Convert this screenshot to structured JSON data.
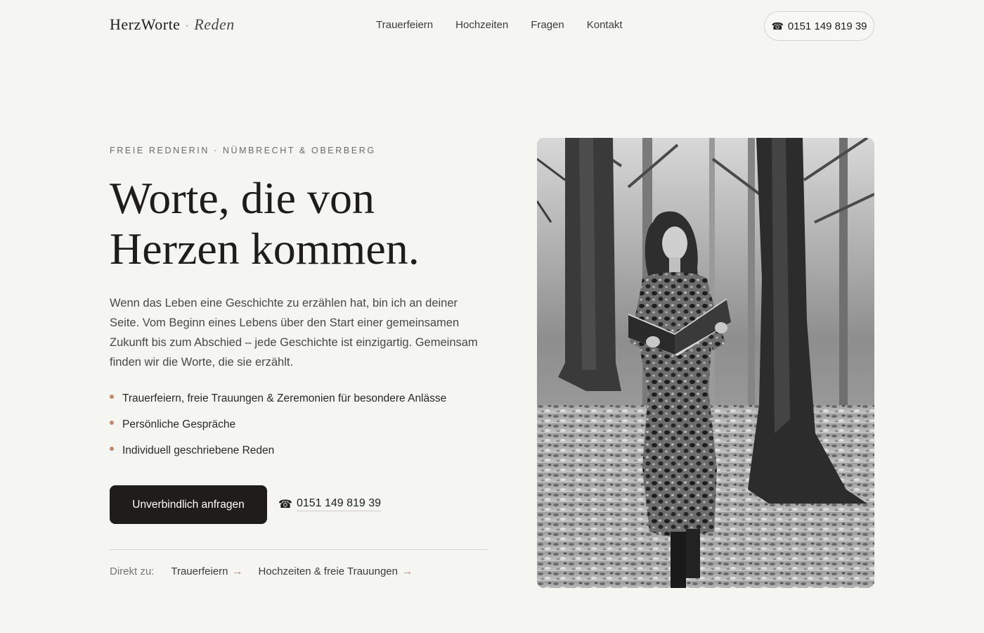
{
  "header": {
    "logo_main": "HerzWorte",
    "logo_dot": "·",
    "logo_sub": "Reden",
    "nav": [
      {
        "label": "Trauerfeiern"
      },
      {
        "label": "Hochzeiten"
      },
      {
        "label": "Fragen"
      },
      {
        "label": "Kontakt"
      }
    ],
    "phone_icon": "phone-icon",
    "phone_glyph": "☎",
    "phone": "0151 149 819 39"
  },
  "hero": {
    "eyebrow": "FREIE REDNERIN · NÜMBRECHT & OBERBERG",
    "headline_line1": "Worte, die von",
    "headline_line2": "Herzen kommen.",
    "intro": "Wenn das Leben eine Geschichte zu erzählen hat, bin ich an deiner Seite. Vom Beginn eines Lebens über den Start einer gemeinsamen Zukunft bis zum Abschied – jede Geschichte ist einzigartig. Gemeinsam finden wir die Worte, die sie erzählt.",
    "bullets": [
      {
        "text": "Trauerfeiern, freie Trauungen & Zeremonien für besondere Anlässe"
      },
      {
        "text": "Persönliche Gespräche"
      },
      {
        "text": "Individuell geschriebene Reden"
      }
    ],
    "cta_label": "Unverbindlich anfragen",
    "cta_phone_glyph": "☎",
    "cta_phone": "0151 149 819 39",
    "direct_label": "Direkt zu:",
    "direct_links": [
      {
        "label": "Trauerfeiern",
        "arrow": "→"
      },
      {
        "label": "Hochzeiten & freie Trauungen",
        "arrow": "→"
      }
    ]
  },
  "colors": {
    "background": "#f5f5f2",
    "text": "#1e1d1b",
    "accent": "#c08a6c",
    "button": "#1e1d1b"
  }
}
